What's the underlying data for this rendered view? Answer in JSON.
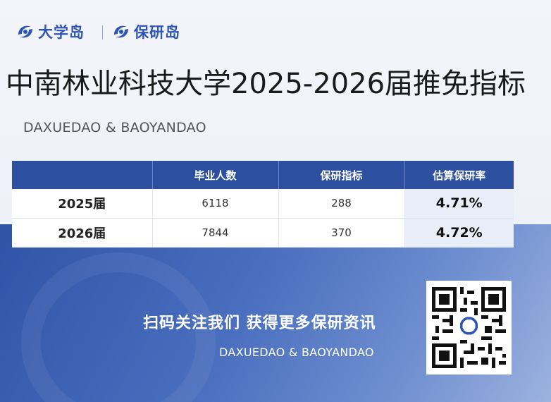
{
  "logos": {
    "left": {
      "text": "大学岛",
      "icon": "daxuedao-logo-icon"
    },
    "right": {
      "text": "保研岛",
      "icon": "baoyandao-logo-icon"
    }
  },
  "title": "中南林业科技大学2025-2026届推免指标",
  "subtitle": "DAXUEDAO & BAOYANDAO",
  "table": {
    "headers": [
      "",
      "毕业人数",
      "保研指标",
      "估算保研率"
    ],
    "rows": [
      {
        "year": "2025届",
        "graduates": "6118",
        "quota": "288",
        "rate": "4.71%"
      },
      {
        "year": "2026届",
        "graduates": "7844",
        "quota": "370",
        "rate": "4.72%"
      }
    ]
  },
  "promo": {
    "text": "扫码关注我们 获得更多保研资讯",
    "sub": "DAXUEDAO & BAOYANDAO",
    "qr_icon": "qr-code-icon"
  },
  "colors": {
    "brand": "#2e55b4",
    "header": "#2d4fa0",
    "rate_bg": "#e9edf8"
  }
}
